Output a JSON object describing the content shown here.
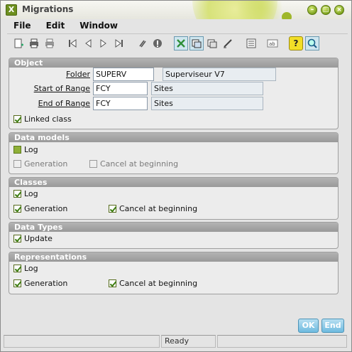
{
  "window": {
    "title": "Migrations",
    "app_icon": "X"
  },
  "window_buttons": [
    "minimize",
    "maximize",
    "close"
  ],
  "menu": [
    {
      "label": "File"
    },
    {
      "label": "Edit"
    },
    {
      "label": "Window"
    }
  ],
  "toolbar_icons": [
    "new-icon",
    "print-icon",
    "print-preview-icon",
    "first-record-icon",
    "previous-record-icon",
    "next-record-icon",
    "last-record-icon",
    "attach-icon",
    "disable-icon",
    "selection-icon",
    "window-icon",
    "copy-window-icon",
    "edit-text-icon",
    "list-icon",
    "text-field-icon",
    "help-icon",
    "search-icon"
  ],
  "object": {
    "header": "Object",
    "folder": {
      "label": "Folder",
      "value": "SUPERV",
      "description": "Superviseur V7"
    },
    "start_range": {
      "label": "Start of Range",
      "value": "FCY",
      "description": "Sites"
    },
    "end_range": {
      "label": "End of Range",
      "value": "FCY",
      "description": "Sites"
    },
    "linked_class": {
      "label": "Linked class",
      "checked": true
    }
  },
  "data_models": {
    "header": "Data models",
    "log": {
      "label": "Log",
      "checked": true
    },
    "generation": {
      "label": "Generation",
      "checked": false,
      "enabled": false
    },
    "cancel": {
      "label": "Cancel at beginning",
      "checked": false,
      "enabled": false
    }
  },
  "classes": {
    "header": "Classes",
    "log": {
      "label": "Log",
      "checked": true
    },
    "generation": {
      "label": "Generation",
      "checked": true
    },
    "cancel": {
      "label": "Cancel at beginning",
      "checked": true
    }
  },
  "data_types": {
    "header": "Data Types",
    "update": {
      "label": "Update",
      "checked": true
    }
  },
  "representations": {
    "header": "Representations",
    "log": {
      "label": "Log",
      "checked": true
    },
    "generation": {
      "label": "Generation",
      "checked": true
    },
    "cancel": {
      "label": "Cancel at beginning",
      "checked": true
    }
  },
  "buttons": {
    "ok": "OK",
    "end": "End"
  },
  "status": {
    "text": "Ready"
  },
  "colors": {
    "accent": "#7da21d",
    "section_header": "#a6a6a6",
    "button": "#6fbbe0"
  }
}
